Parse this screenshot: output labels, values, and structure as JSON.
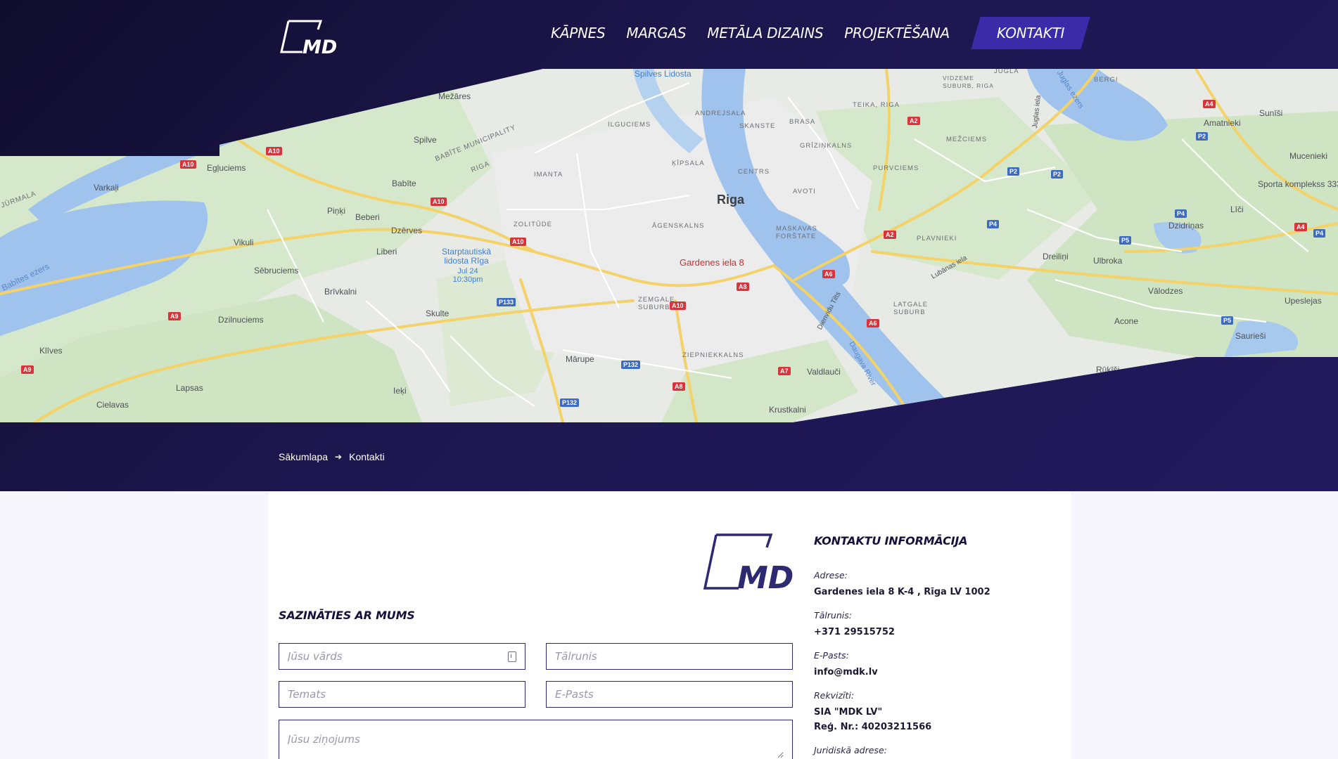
{
  "nav": {
    "items": [
      {
        "label": "KĀPNES"
      },
      {
        "label": "MARGAS"
      },
      {
        "label": "METĀLA DIZAINS"
      },
      {
        "label": "PROJEKTĒŠANA"
      }
    ],
    "active_label": "KONTAKTI"
  },
  "logo": {
    "text": "MDK"
  },
  "map": {
    "pin_label": "Gardenes iela 8",
    "city": "Riga",
    "places": [
      "Spilves Lidosta",
      "Mežāres",
      "Spilve",
      "Egļuciems",
      "Babīte",
      "Varkaļi",
      "Piņķi",
      "Beberi",
      "Dzērves",
      "Vikuli",
      "Liberi",
      "Sēbruciems",
      "Brīvkalni",
      "Skulte",
      "Dzilnuciems",
      "Klīves",
      "Lapsas",
      "Cielavas",
      "Ieķi",
      "Mārupe",
      "Valdlauči",
      "Krustkalni",
      "Sunīši",
      "Amatnieki",
      "Mucenieki",
      "Līči",
      "Dzidriņas",
      "Dreiliņi",
      "Ulbroka",
      "Vālodzes",
      "Upeslejas",
      "Acone",
      "Saurieši",
      "Rūķīši",
      "Sporta komplekss 333"
    ],
    "districts": [
      "ANDREJSALA",
      "SKANSTE",
      "BRASA",
      "TEIKA, RIGA",
      "ILGUCIEMS",
      "ĶĪPSALA",
      "CENTRS",
      "GRĪZIŅKALNS",
      "MEŽCIEMS",
      "PURVCIEMS",
      "IMANTA",
      "AVOTI",
      "ĀGENSKALNS",
      "MASKAVAS FORŠTATE",
      "PLAVNIEKI",
      "ZOLITŪDE",
      "ZEMGALE SUBURB",
      "LATGALE SUBURB",
      "ZIEPNIEKKALNS",
      "VIDZEME SUBURB, RIGA",
      "JUGLA",
      "BERGI"
    ],
    "municipalities": [
      "BABĪTE MUNICIPALITY",
      "RIGA",
      "JŪRMALA"
    ],
    "airport": "Starptautiskā lidosta Rīga",
    "airport_time": "Jul 24 10:30pm",
    "waters": [
      "Babītes ezers",
      "Daugava River",
      "Juglas ezers"
    ],
    "streets": [
      "Lubānas iela",
      "Dienvidu Tilts",
      "Juglas iela"
    ],
    "roads": {
      "red": [
        "A10",
        "A10",
        "A10",
        "A10",
        "A10",
        "A9",
        "A9",
        "A8",
        "A8",
        "A7",
        "A6",
        "A6",
        "A2",
        "A2",
        "A4",
        "A4"
      ],
      "blue": [
        "P133",
        "P132",
        "P132",
        "P2",
        "P2",
        "P2",
        "P4",
        "P4",
        "P5",
        "P5",
        "P4"
      ]
    }
  },
  "breadcrumb": {
    "home": "Sākumlapa",
    "current": "Kontakti"
  },
  "form": {
    "title": "SAZINĀTIES AR MUMS",
    "name_placeholder": "Jūsu vārds",
    "phone_placeholder": "Tālrunis",
    "subject_placeholder": "Temats",
    "email_placeholder": "E-Pasts",
    "message_placeholder": "Jūsu ziņojums"
  },
  "contact": {
    "title": "KONTAKTU INFORMĀCIJA",
    "address_label": "Adrese:",
    "address_value": "Gardenes iela 8 K-4 , Rīga LV 1002",
    "phone_label": "Tālrunis:",
    "phone_value": "+371 29515752",
    "email_label": "E-Pasts:",
    "email_value": "info@mdk.lv",
    "requisites_label": "Rekvizīti:",
    "company_name": "SIA \"MDK LV\"",
    "reg_number": "Reģ. Nr.: 40203211566",
    "legal_address_label": "Juridiskā adrese:"
  },
  "colors": {
    "header_dark": "#110d2d",
    "header_mid": "#1d1750",
    "accent": "#3b2ba8",
    "map_land": "#e8eae6",
    "map_water": "#9fc3ec",
    "map_green": "#cfe4c2",
    "map_road": "#f7d879",
    "pin": "#d33a2c"
  }
}
